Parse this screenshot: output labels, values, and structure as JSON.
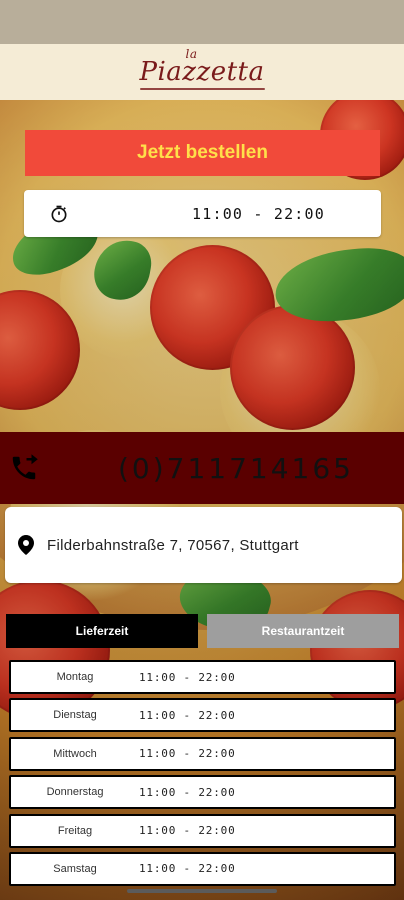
{
  "header": {
    "brand_small": "la",
    "brand_main": "Piazzetta"
  },
  "actions": {
    "order_label": "Jetzt bestellen"
  },
  "hours_card": {
    "icon": "stopwatch-icon",
    "time": "11:00 - 22:00"
  },
  "contact": {
    "phone_icon": "phone-forward-icon",
    "phone": "(0)711714165"
  },
  "address": {
    "icon": "location-pin-icon",
    "text": "Filderbahnstraße 7, 70567, Stuttgart"
  },
  "tabs": [
    {
      "label": "Lieferzeit",
      "active": true
    },
    {
      "label": "Restaurantzeit",
      "active": false
    }
  ],
  "schedule": [
    {
      "day": "Montag",
      "time": "11:00 - 22:00"
    },
    {
      "day": "Dienstag",
      "time": "11:00 - 22:00"
    },
    {
      "day": "Mittwoch",
      "time": "11:00 - 22:00"
    },
    {
      "day": "Donnerstag",
      "time": "11:00 - 22:00"
    },
    {
      "day": "Freitag",
      "time": "11:00 - 22:00"
    },
    {
      "day": "Samstag",
      "time": "11:00 - 22:00"
    }
  ],
  "colors": {
    "order_bg": "#f14a3a",
    "order_text": "#ffe04a",
    "phone_band": "#5a0000",
    "header_bg": "#f5ecd6",
    "brand": "#7a1b1b"
  }
}
